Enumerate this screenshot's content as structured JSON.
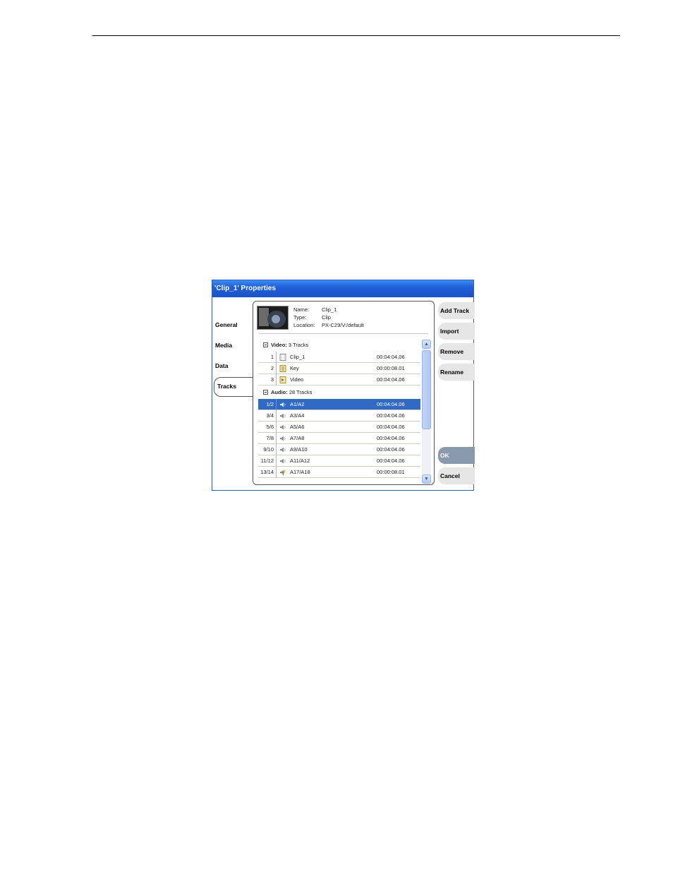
{
  "dialog": {
    "title": "'Clip_1' Properties"
  },
  "tabs": [
    {
      "label": "General",
      "active": false
    },
    {
      "label": "Media",
      "active": false
    },
    {
      "label": "Data",
      "active": false
    },
    {
      "label": "Tracks",
      "active": true
    }
  ],
  "clip_info": {
    "name_label": "Name:",
    "name_value": "Clip_1",
    "type_label": "Type:",
    "type_value": "Clip",
    "location_label": "Location:",
    "location_value": "PX-C29/V:/default"
  },
  "video_group": {
    "label": "Video:",
    "count": "3 Tracks"
  },
  "video_tracks": [
    {
      "num": "1",
      "icon": "clip-icon",
      "name": "Clip_1",
      "tc": "00:04:04.06"
    },
    {
      "num": "2",
      "icon": "key-track-icon",
      "name": "Key",
      "tc": "00:00:08.01"
    },
    {
      "num": "3",
      "icon": "video-track-icon",
      "name": "Video",
      "tc": "00:04:04.06"
    }
  ],
  "audio_group": {
    "label": "Audio:",
    "count": "28 Tracks"
  },
  "audio_tracks": [
    {
      "num": "1/2",
      "icon": "speaker-icon",
      "name": "A1/A2",
      "tc": "00:04:04.06",
      "selected": true
    },
    {
      "num": "3/4",
      "icon": "speaker-icon",
      "name": "A3/A4",
      "tc": "00:04:04.06"
    },
    {
      "num": "5/6",
      "icon": "speaker-icon",
      "name": "A5/A6",
      "tc": "00:04:04.06"
    },
    {
      "num": "7/8",
      "icon": "speaker-icon",
      "name": "A7/A8",
      "tc": "00:04:04.06"
    },
    {
      "num": "9/10",
      "icon": "speaker-icon",
      "name": "A9/A10",
      "tc": "00:04:04.06"
    },
    {
      "num": "11/12",
      "icon": "speaker-icon",
      "name": "A11/A12",
      "tc": "00:04:04.06"
    },
    {
      "num": "13/14",
      "icon": "speaker-edited-icon",
      "name": "A17/A18",
      "tc": "00:00:08.01"
    }
  ],
  "side_buttons": {
    "add_track": "Add Track",
    "import": "Import",
    "remove": "Remove",
    "rename": "Rename",
    "ok": "OK",
    "cancel": "Cancel"
  },
  "colors": {
    "selection": "#316ac5",
    "titlebar": "#1f5fd8",
    "ok_button": "#8a9aad"
  }
}
